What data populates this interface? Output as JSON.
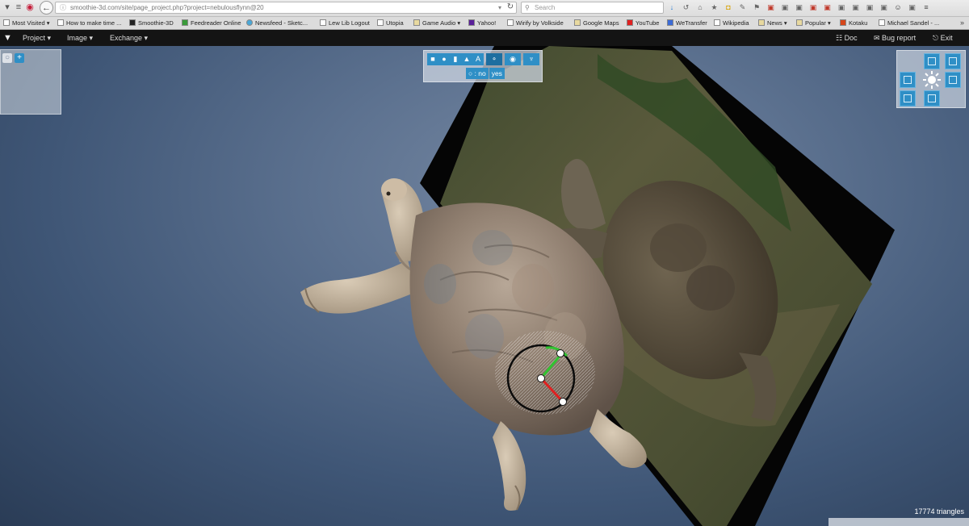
{
  "browser": {
    "url": "smoothie-3d.com/site/page_project.php?project=nebulousflynn@20",
    "search_placeholder": "Search",
    "bookmarks": [
      {
        "label": "Most Visited",
        "dropdown": true
      },
      {
        "label": "How to make time ...",
        "dropdown": false
      },
      {
        "label": "Smoothie-3D",
        "dropdown": false
      },
      {
        "label": "Feedreader Online",
        "dropdown": false
      },
      {
        "label": "Newsfeed - Sketc...",
        "dropdown": false
      },
      {
        "label": "Lew Lib Logout",
        "dropdown": false
      },
      {
        "label": "Utopia",
        "dropdown": false
      },
      {
        "label": "Game Audio",
        "dropdown": true
      },
      {
        "label": "Yahoo!",
        "dropdown": false
      },
      {
        "label": "Wirify by Volkside",
        "dropdown": false
      },
      {
        "label": "Google Maps",
        "dropdown": false
      },
      {
        "label": "YouTube",
        "dropdown": false
      },
      {
        "label": "WeTransfer",
        "dropdown": false
      },
      {
        "label": "Wikipedia",
        "dropdown": false
      },
      {
        "label": "News",
        "dropdown": true
      },
      {
        "label": "Popular",
        "dropdown": true
      },
      {
        "label": "Kotaku",
        "dropdown": false
      },
      {
        "label": "Michael Sandel - ...",
        "dropdown": false
      }
    ],
    "toolbar_icons": [
      "download-icon",
      "history-icon",
      "home-icon",
      "bookmark-star-icon",
      "pocket-icon",
      "pen-icon",
      "flag-icon",
      "extension-icon",
      "extension-icon",
      "extension-icon",
      "extension-icon",
      "extension-icon",
      "extension-icon",
      "extension-icon",
      "extension-icon",
      "extension-icon",
      "smiley-icon",
      "extension-icon",
      "menu-icon"
    ]
  },
  "app": {
    "menus": [
      "Project",
      "Image",
      "Exchange"
    ],
    "right": {
      "doc": "Doc",
      "bug_report": "Bug report",
      "exit": "Exit"
    }
  },
  "viewport": {
    "toggle_label": "no",
    "toggle_value": "yes",
    "triangle_count": "17774 triangles"
  },
  "colors": {
    "tool_accent": "#2f8fc6",
    "app_bar": "#141414",
    "viewport_bg": "#3f5676",
    "gizmo_x": "#e02020",
    "gizmo_y": "#31c431"
  }
}
